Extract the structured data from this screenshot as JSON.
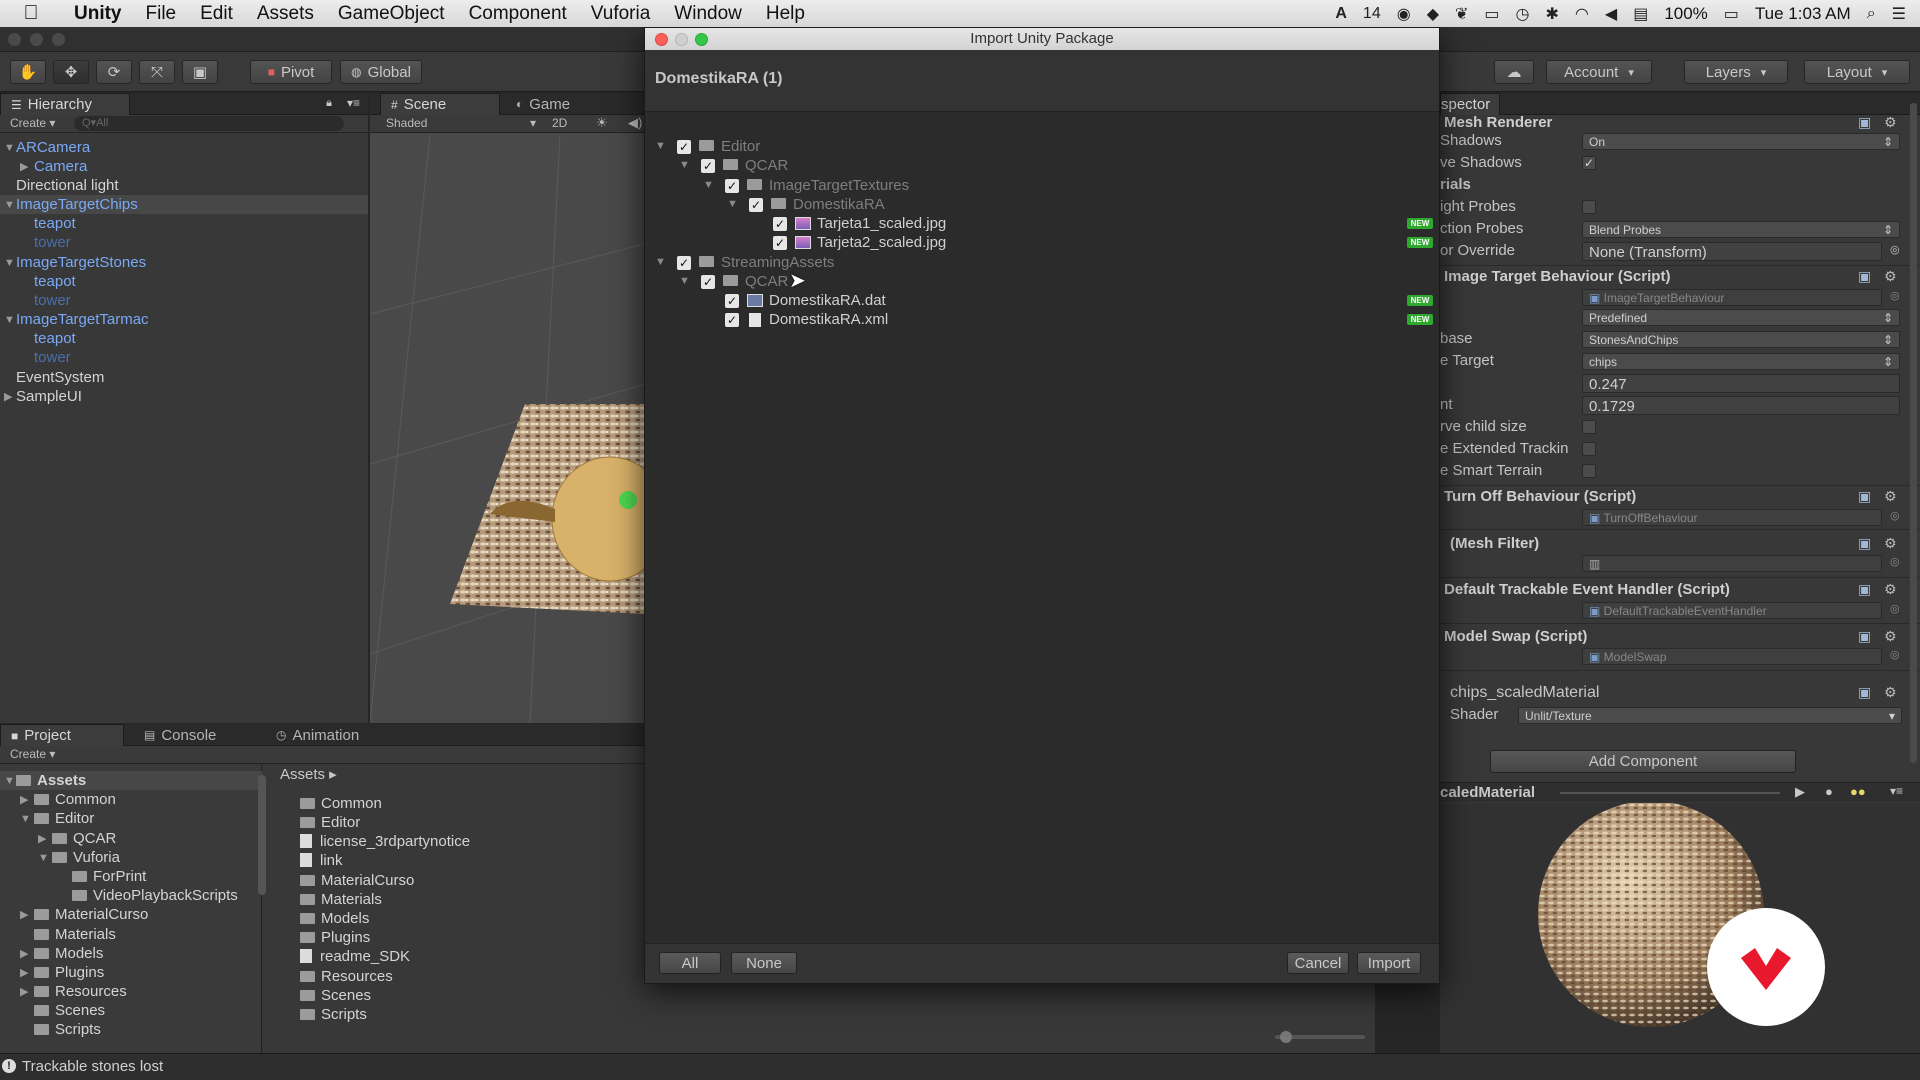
{
  "menubar": {
    "app": "Unity",
    "items": [
      "File",
      "Edit",
      "Assets",
      "GameObject",
      "Component",
      "Vuforia",
      "Window",
      "Help"
    ],
    "status_input": "14",
    "battery": "100%",
    "clock": "Tue 1:03 AM"
  },
  "toolbar": {
    "pivot": "Pivot",
    "global": "Global",
    "account": "Account",
    "layers": "Layers",
    "layout": "Layout"
  },
  "hierarchy": {
    "tab": "Hierarchy",
    "create": "Create",
    "search_placeholder": "Q▾All",
    "items": [
      {
        "label": "ARCamera"
      },
      {
        "label": "Camera"
      },
      {
        "label": "Directional light"
      },
      {
        "label": "ImageTargetChips"
      },
      {
        "label": "teapot"
      },
      {
        "label": "tower"
      },
      {
        "label": "ImageTargetStones"
      },
      {
        "label": "teapot"
      },
      {
        "label": "tower"
      },
      {
        "label": "ImageTargetTarmac"
      },
      {
        "label": "teapot"
      },
      {
        "label": "tower"
      },
      {
        "label": "EventSystem"
      },
      {
        "label": "SampleUI"
      }
    ]
  },
  "scene": {
    "tab_scene": "Scene",
    "tab_game": "Game",
    "shading": "Shaded",
    "mode_2d": "2D"
  },
  "project": {
    "tabs": [
      "Project",
      "Console",
      "Animation"
    ],
    "create": "Create",
    "tree": [
      "Assets",
      "Common",
      "Editor",
      "QCAR",
      "Vuforia",
      "ForPrint",
      "VideoPlaybackScripts",
      "MaterialCurso",
      "Materials",
      "Models",
      "Plugins",
      "Resources",
      "Scenes",
      "Scripts"
    ],
    "breadcrumb": "Assets",
    "files": [
      "Common",
      "Editor",
      "license_3rdpartynotice",
      "link",
      "MaterialCurso",
      "Materials",
      "Models",
      "Plugins",
      "readme_SDK",
      "Resources",
      "Scenes",
      "Scripts"
    ]
  },
  "dialog": {
    "title": "Import Unity Package",
    "package": "DomestikaRA (1)",
    "tree": [
      {
        "label": "Editor"
      },
      {
        "label": "QCAR"
      },
      {
        "label": "ImageTargetTextures"
      },
      {
        "label": "DomestikaRA"
      },
      {
        "label": "Tarjeta1_scaled.jpg",
        "badge": "NEW"
      },
      {
        "label": "Tarjeta2_scaled.jpg",
        "badge": "NEW"
      },
      {
        "label": "StreamingAssets"
      },
      {
        "label": "QCAR"
      },
      {
        "label": "DomestikaRA.dat",
        "badge": "NEW"
      },
      {
        "label": "DomestikaRA.xml",
        "badge": "NEW"
      }
    ],
    "btn_all": "All",
    "btn_none": "None",
    "btn_cancel": "Cancel",
    "btn_import": "Import"
  },
  "inspector": {
    "tab": "spector",
    "mesh_renderer": "Mesh Renderer",
    "shadows_label": "Shadows",
    "shadows_value": "On",
    "receive_shadows_label": "ve Shadows",
    "materials_label": "rials",
    "light_probes_label": "ight Probes",
    "reflection_probes_label": "ction Probes",
    "reflection_probes_value": "Blend Probes",
    "anchor_override_label": "or Override",
    "anchor_override_value": "None (Transform)",
    "itb_title": "Image Target Behaviour (Script)",
    "itb_script": "ImageTargetBehaviour",
    "itb_type": "Predefined",
    "database_label": "base",
    "database_value": "StonesAndChips",
    "target_label": "e Target",
    "target_value": "chips",
    "width_value": "0.247",
    "height_label": "nt",
    "height_value": "0.1729",
    "preserve_child_label": "rve child size",
    "extended_tracking_label": "e Extended Trackin",
    "smart_terrain_label": "e Smart Terrain",
    "turnoff_title": "Turn Off Behaviour (Script)",
    "turnoff_script": "TurnOffBehaviour",
    "meshfilter_title": "(Mesh Filter)",
    "dteh_title": "Default Trackable Event Handler (Script)",
    "dteh_script": "DefaultTrackableEventHandler",
    "modelswap_title": "Model Swap (Script)",
    "modelswap_script": "ModelSwap",
    "material_name": "chips_scaledMaterial",
    "shader_label": "Shader",
    "shader_value": "Unlit/Texture",
    "add_component": "Add Component",
    "preview_title": "caledMaterial"
  },
  "status": {
    "message": "Trackable stones lost"
  }
}
